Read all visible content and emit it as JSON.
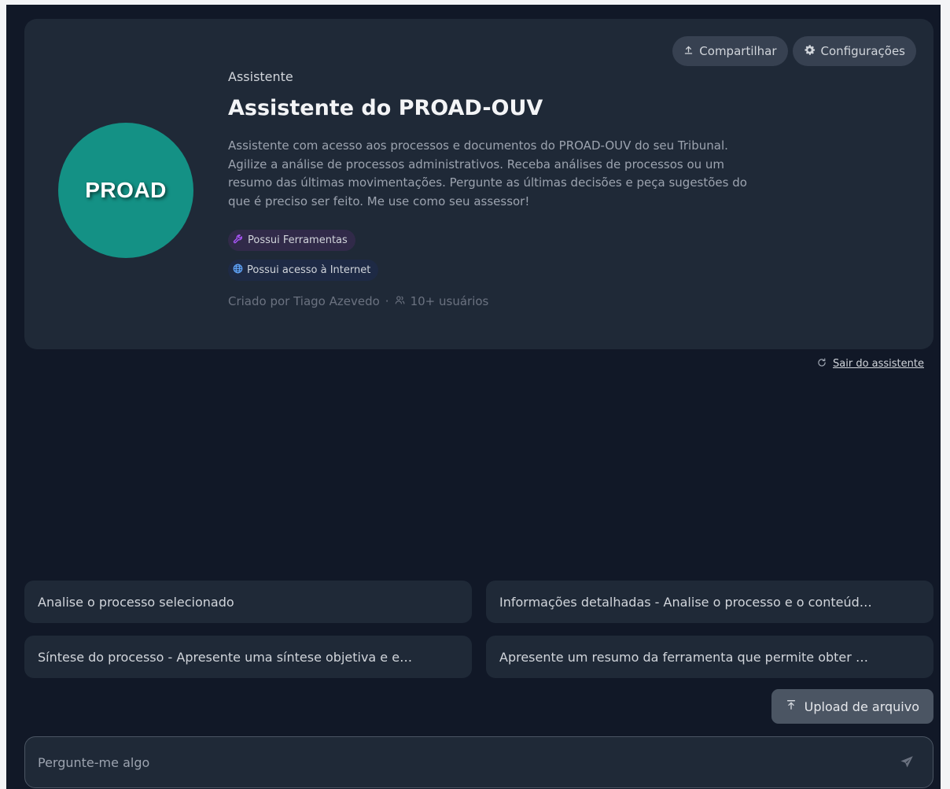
{
  "assistant": {
    "avatar_text": "PROAD",
    "kicker": "Assistente",
    "title": "Assistente do PROAD-OUV",
    "description": "Assistente com acesso aos processos e documentos do PROAD-OUV do seu Tribunal. Agilize a análise de processos administrativos. Receba análises de processos ou um resumo das últimas movimentações. Pergunte as últimas decisões e peça sugestões do que é preciso ser feito. Me use como seu assessor!",
    "badges": {
      "tools": "Possui Ferramentas",
      "internet": "Possui acesso à Internet"
    },
    "meta": {
      "creator": "Criado por Tiago Azevedo",
      "separator": "·",
      "users": "10+ usuários"
    }
  },
  "actions": {
    "share_label": "Compartilhar",
    "settings_label": "Configurações"
  },
  "exit_label": "Sair do assistente",
  "suggestions": [
    "Analise o processo selecionado",
    "Informações detalhadas - Analise o processo e o conteúd…",
    "Síntese do processo - Apresente uma síntese objetiva e e…",
    "Apresente um resumo da ferramenta que permite obter …"
  ],
  "upload_label": "Upload de arquivo",
  "chat": {
    "placeholder": "Pergunte-me algo",
    "value": ""
  },
  "icons": {
    "share": "upload-arrow-icon",
    "settings": "gear-icon",
    "tools": "wrench-icon",
    "internet": "globe-icon",
    "users": "users-icon",
    "exit": "refresh-icon",
    "upload": "upload-icon",
    "send": "send-icon"
  },
  "colors": {
    "background": "#111827",
    "card": "#1f2937",
    "avatar": "#149185",
    "tools_badge_accent": "#a855f7",
    "internet_badge_accent": "#60a5fa"
  }
}
